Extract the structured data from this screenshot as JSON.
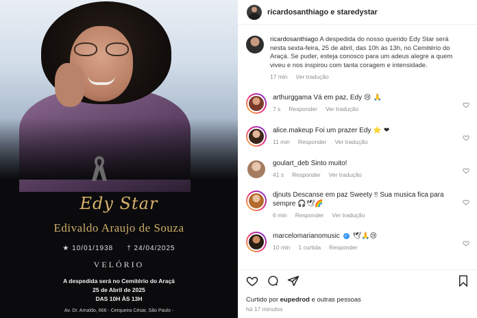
{
  "memorial": {
    "name_script": "Edy Star",
    "full_name": "Edivaldo Araujo de Souza",
    "birth_mark": "★",
    "birth": "10/01/1938",
    "death_mark": "†",
    "death": "24/04/2025",
    "event": "VELÓRIO",
    "info_line1": "A despedida será no Cemitério do Araçá",
    "info_line2": "25 de Abril de 2025",
    "info_line3": "DAS 10H ÀS 13H",
    "address": "Av. Dr. Arnaldo, 666 - Cerqueira César, São Paulo -"
  },
  "header": {
    "accounts": "ricardosanthiago e staredystar"
  },
  "caption": {
    "username": "ricardosanthiago",
    "text": "A despedida do nosso querido Edy Star será nesta sexta-feira, 25 de abril, das 10h às 13h, no Cemitério do Araçá. Se puder, esteja conosco para um adeus alegre a quem viveu e nos inspirou com tanta coragem e intensidade.",
    "time": "17 min",
    "translate": "Ver tradução"
  },
  "comments": [
    {
      "username": "arthurggama",
      "text": "Vá em paz, Edy",
      "emoji": "😢 🙏",
      "time": "7 s",
      "reply": "Responder",
      "translate": "Ver tradução",
      "likes": "",
      "verified": false
    },
    {
      "username": "alice.makeup",
      "text": "Foi um prazer Edy",
      "emoji": "⭐ ❤",
      "time": "11 min",
      "reply": "Responder",
      "translate": "Ver tradução",
      "likes": "",
      "verified": false
    },
    {
      "username": "goulart_deb",
      "text": "Sinto muito!",
      "emoji": "",
      "time": "41 s",
      "reply": "Responder",
      "translate": "Ver tradução",
      "likes": "",
      "verified": false
    },
    {
      "username": "djnuts",
      "text": "Descanse em paz Sweety !! Sua musica fica para sempre",
      "emoji": "🎧🕊🌈",
      "time": "6 min",
      "reply": "Responder",
      "translate": "Ver tradução",
      "likes": "",
      "verified": false
    },
    {
      "username": "marcelomarianomusic",
      "text": "",
      "emoji": "🕊🙏😢",
      "time": "10 min",
      "reply": "Responder",
      "translate": "",
      "likes": "1 curtida",
      "verified": true
    }
  ],
  "actions": {
    "liked_prefix": "Curtido por",
    "liked_user": "eupedrod",
    "liked_suffix": "e outras pessoas",
    "time_ago": "há 17 minutos"
  },
  "colors": {
    "gold": "#cfae6a",
    "verified_blue": "#3897f0",
    "meta_gray": "#8e8e8e"
  }
}
